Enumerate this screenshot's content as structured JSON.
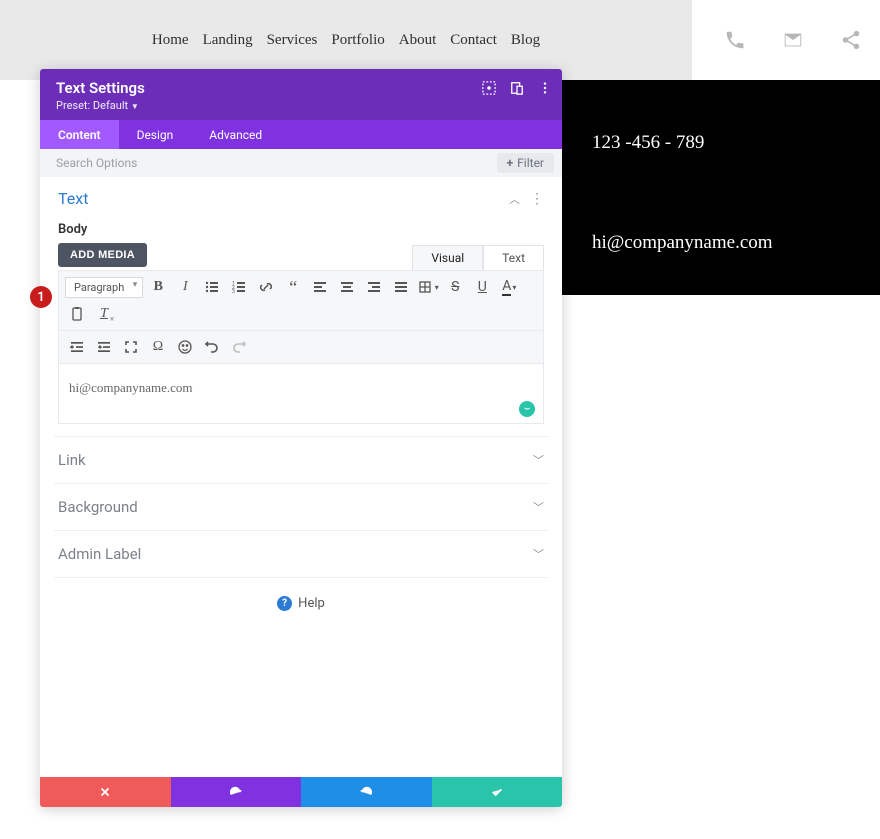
{
  "nav": {
    "items": [
      "Home",
      "Landing",
      "Services",
      "Portfolio",
      "About",
      "Contact",
      "Blog"
    ]
  },
  "side_panel": {
    "phone": "123 -456 - 789",
    "email": "hi@companyname.com"
  },
  "modal": {
    "title": "Text Settings",
    "preset": "Preset: Default",
    "tabs": [
      "Content",
      "Design",
      "Advanced"
    ],
    "search_placeholder": "Search Options",
    "filter": "Filter",
    "text_section": {
      "title": "Text",
      "body_label": "Body",
      "add_media": "ADD MEDIA",
      "ed_tabs": [
        "Visual",
        "Text"
      ],
      "paragraph": "Paragraph",
      "content": "hi@companyname.com"
    },
    "collapsed": [
      "Link",
      "Background",
      "Admin Label"
    ],
    "help": "Help"
  },
  "callout": "1"
}
